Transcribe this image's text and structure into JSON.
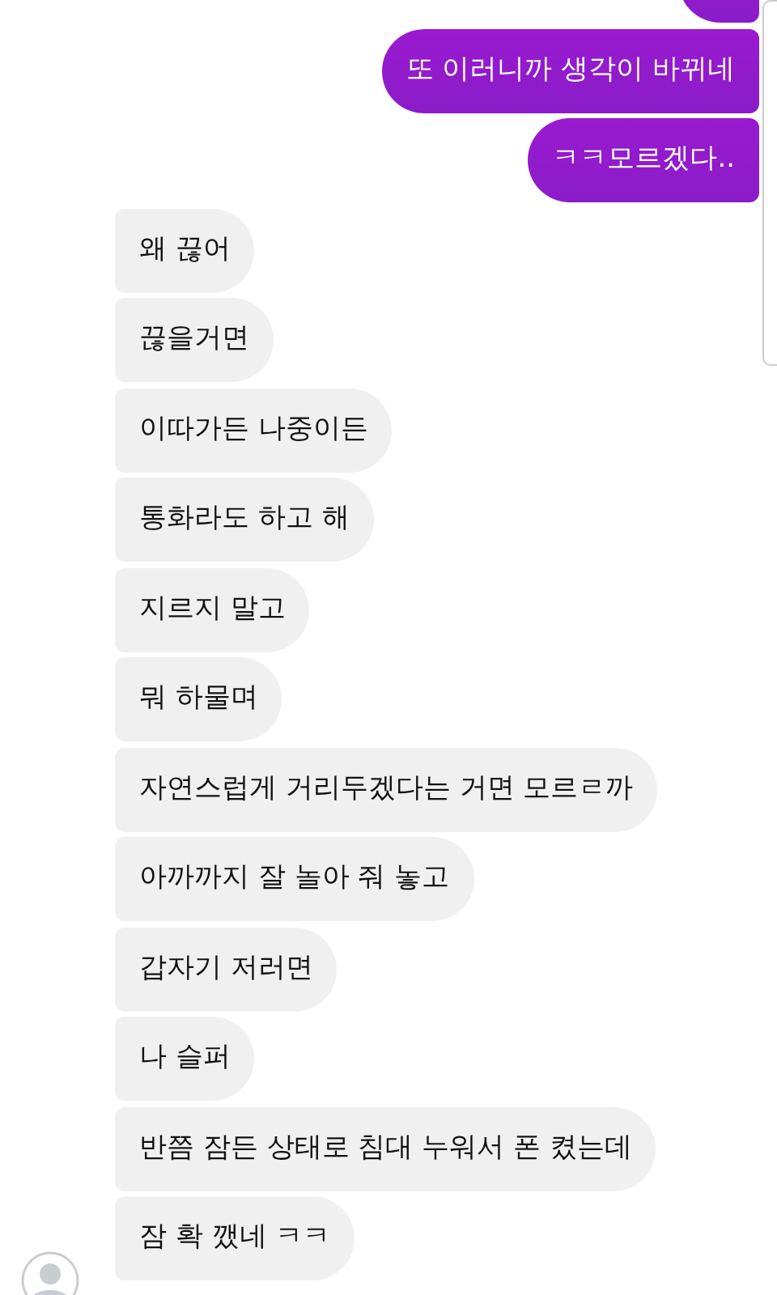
{
  "messages": [
    {
      "kind": "sent",
      "text": "또 이러니까 생각이 바뀌네"
    },
    {
      "kind": "sent",
      "text": "ㅋㅋ모르겠다.."
    },
    {
      "kind": "received",
      "text": "왜 끊어"
    },
    {
      "kind": "received",
      "text": "끊을거면"
    },
    {
      "kind": "received",
      "text": "이따가든 나중이든"
    },
    {
      "kind": "received",
      "text": "통화라도 하고 해"
    },
    {
      "kind": "received",
      "text": "지르지 말고"
    },
    {
      "kind": "received",
      "text": "뭐 하물며"
    },
    {
      "kind": "received",
      "text": "자연스럽게 거리두겠다는 거면 모르ㄹ까"
    },
    {
      "kind": "received",
      "text": "아까까지 잘 놀아 줘 놓고"
    },
    {
      "kind": "received",
      "text": "갑자기 저러면"
    },
    {
      "kind": "received",
      "text": "나 슬퍼"
    },
    {
      "kind": "received",
      "text": "반쯤 잠든 상태로 침대 누워서 폰 켰는데"
    },
    {
      "kind": "received",
      "text": "잠 확 깼네 ㅋㅋ"
    }
  ]
}
